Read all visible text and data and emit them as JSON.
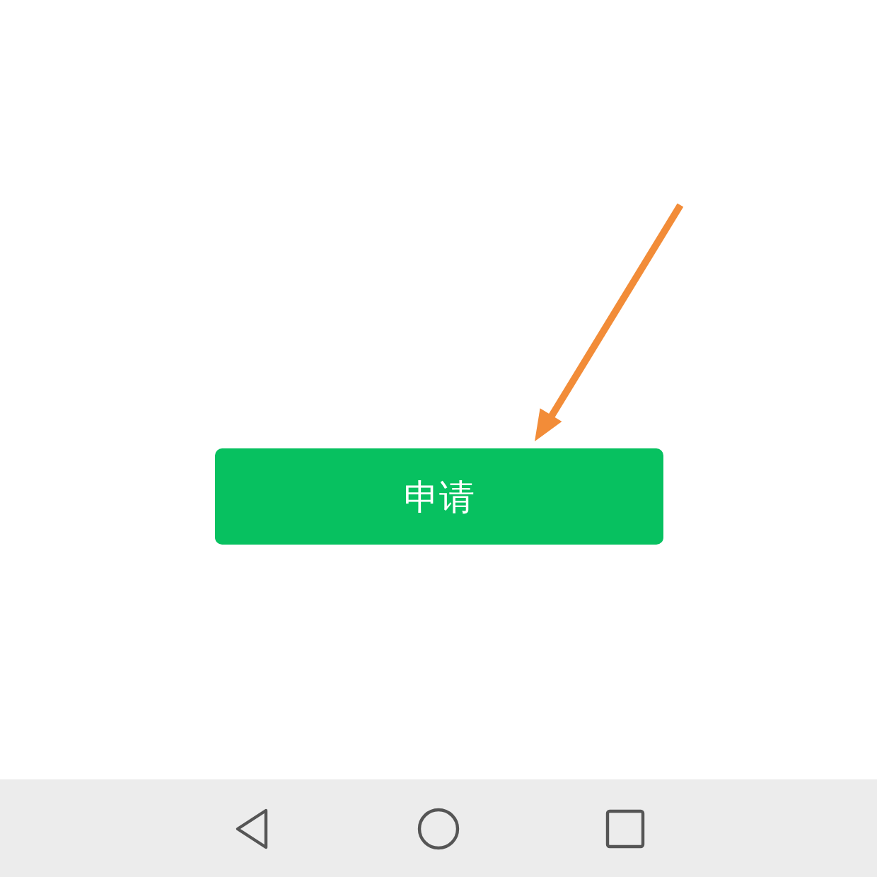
{
  "button": {
    "label": "申请"
  },
  "nav_bar": {
    "buttons": [
      {
        "kind": "back"
      },
      {
        "kind": "home"
      },
      {
        "kind": "recents"
      }
    ]
  }
}
